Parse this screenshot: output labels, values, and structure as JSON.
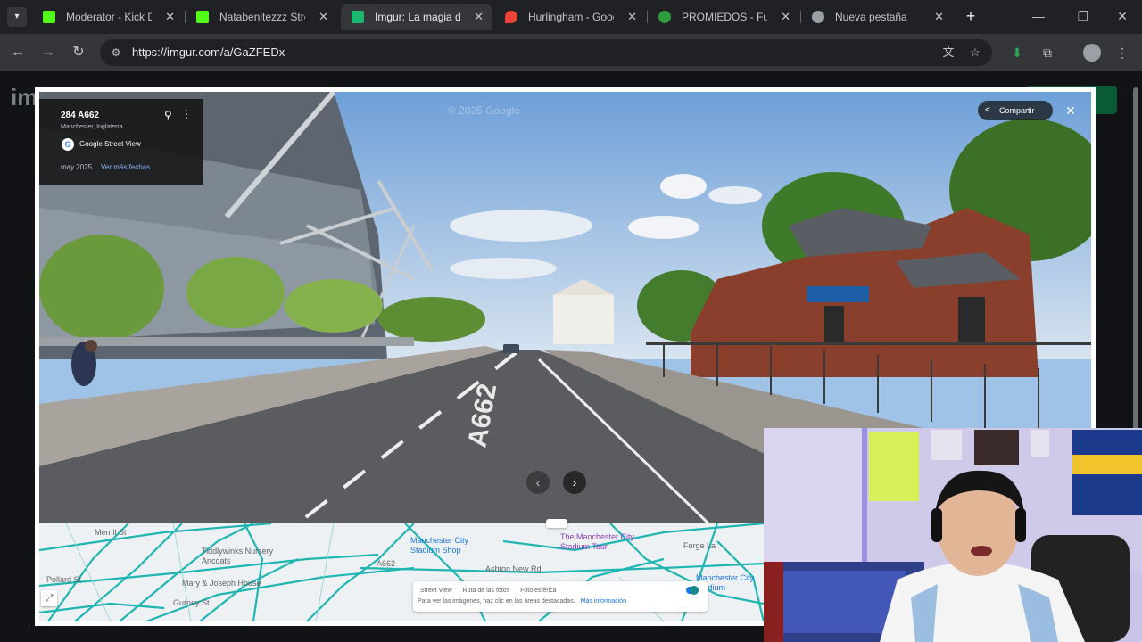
{
  "tabs": [
    {
      "title": "Moderator - Kick Das",
      "favicon_color": "#53fc18",
      "favicon": "K",
      "active": false
    },
    {
      "title": "Natabenitezzz Stream",
      "favicon_color": "#53fc18",
      "favicon": "K",
      "active": false
    },
    {
      "title": "Imgur: La magia de Inte",
      "favicon_color": "#1bb76e",
      "favicon": "imgur",
      "active": true
    },
    {
      "title": "Hurlingham - Google",
      "favicon_color": "#ea4335",
      "favicon": "maps-pin",
      "active": false
    },
    {
      "title": "PROMIEDOS - Futbol",
      "favicon_color": "#2e9b3e",
      "favicon": "promiedos",
      "active": false
    },
    {
      "title": "Nueva pestaña",
      "favicon_color": "#9aa0a6",
      "favicon": "chrome",
      "active": false
    }
  ],
  "toolbar": {
    "url": "https://imgur.com/a/GaZFEDx"
  },
  "streetview": {
    "address": "284 A662",
    "city": "Manchester, Inglaterra",
    "brand": "Google Street View",
    "date": "may 2025",
    "more_dates": "Ver más fechas",
    "share_label": "Compartir",
    "watermark": "© 2025 Google",
    "road_marking": "A662"
  },
  "map": {
    "labels": {
      "merrill": "Merrill St",
      "tiddlywinks": "Tiddlywinks Nursery Ancoats",
      "mary_joseph": "Mary & Joseph House",
      "city_shop": "Manchester City Stadium Shop",
      "stadium_tour": "The Manchester City Stadium Tour",
      "ashton": "Ashton New Rd",
      "a662": "A662",
      "pollard": "Pollard St",
      "gurney": "Gurney St",
      "city_stadium": "Manchester City Stadium",
      "forge": "Forge La"
    },
    "legend": {
      "street_view": "Street View",
      "photo_route": "Ruta de las fotos",
      "spherical": "Foto esférica",
      "hint": "Para ver las imágenes, haz clic en las áreas destacadas.",
      "more_info": "Más información"
    }
  }
}
